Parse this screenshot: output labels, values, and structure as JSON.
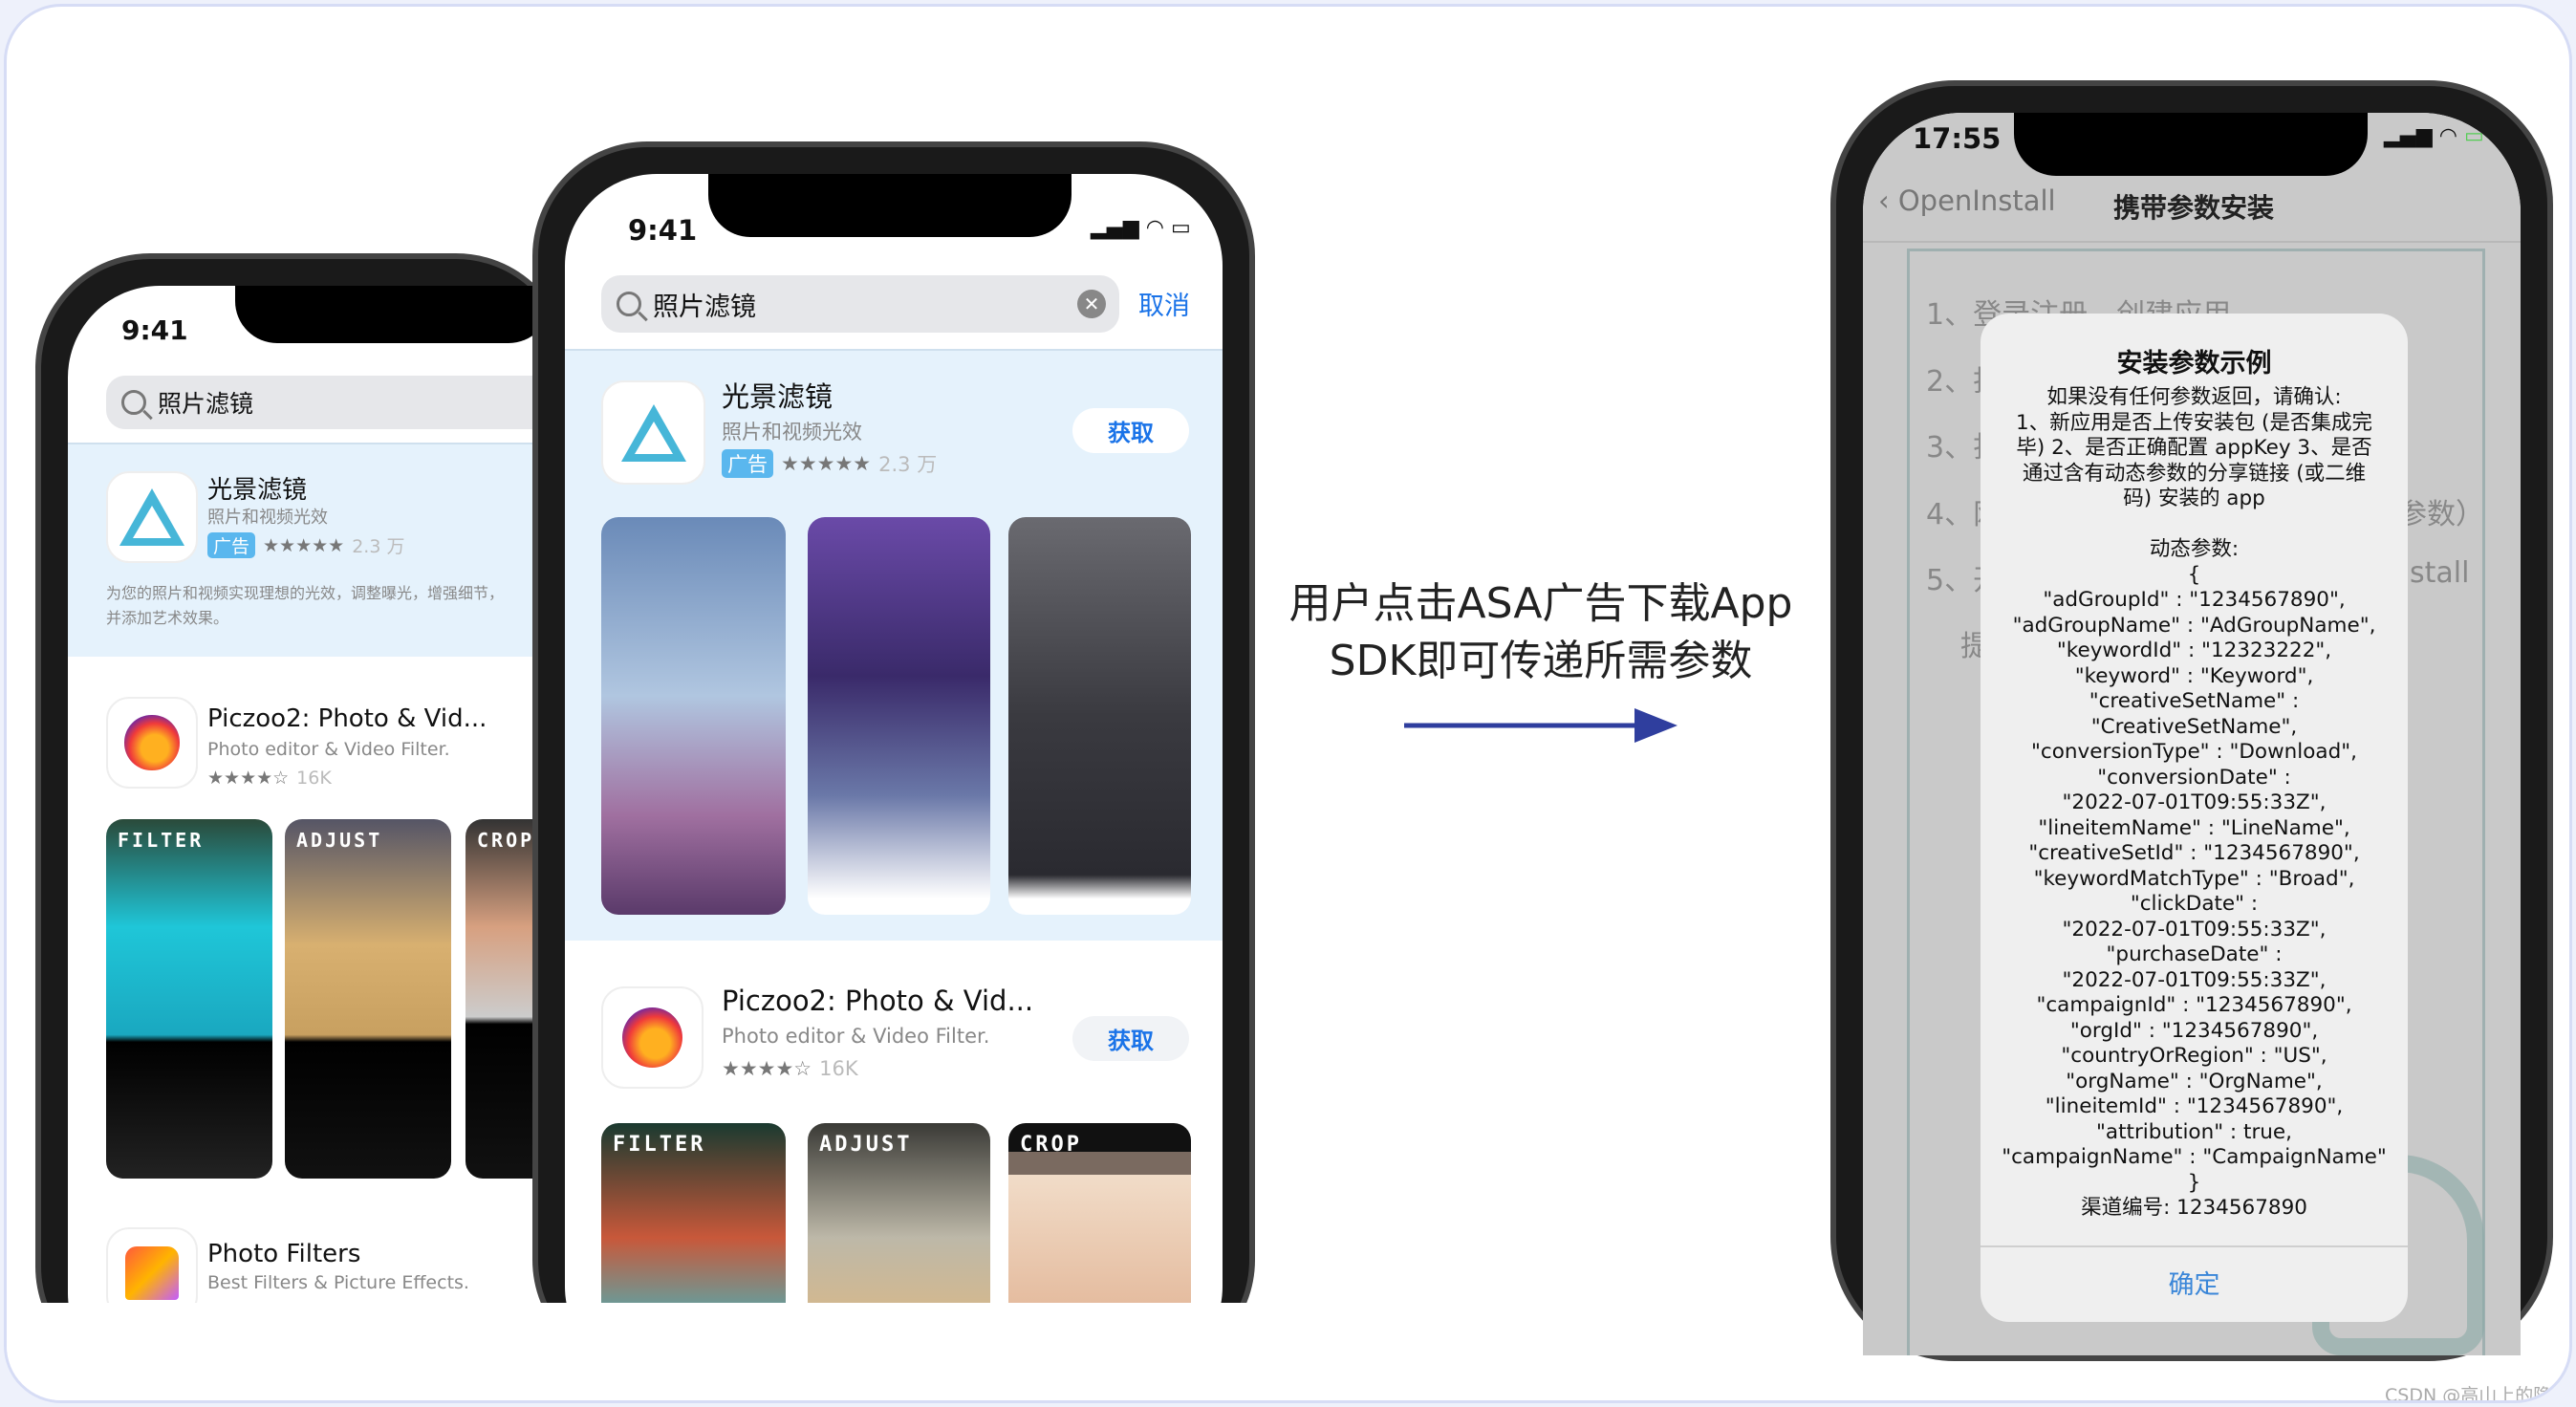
{
  "phone_back": {
    "time": "9:41",
    "search_value": "照片滤镜",
    "featured": {
      "title": "光景滤镜",
      "subtitle": "照片和视频光效",
      "ad_label": "广告",
      "stars": "★★★★★",
      "rating_count": "2.3 万",
      "description_lines": [
        "为您的照片和视频实现理想的光效，调整曝光，增强细节，",
        "并添加艺术效果。"
      ]
    },
    "app2": {
      "title": "Piczoo2: Photo & Vid...",
      "subtitle": "Photo editor & Video Filter.",
      "stars": "★★★★☆",
      "rating_count": "16K"
    },
    "screenshot_labels": [
      "FILTER",
      "ADJUST",
      "CROP"
    ],
    "app3": {
      "title": "Photo Filters",
      "subtitle": "Best Filters & Picture Effects."
    }
  },
  "phone_front": {
    "time": "9:41",
    "search_value": "照片滤镜",
    "cancel_label": "取消",
    "featured": {
      "title": "光景滤镜",
      "subtitle": "照片和视频光效",
      "ad_label": "广告",
      "stars": "★★★★★",
      "rating_count": "2.3 万",
      "get_label": "获取"
    },
    "app2": {
      "title": "Piczoo2: Photo & Vid...",
      "subtitle": "Photo editor & Video Filter.",
      "stars": "★★★★☆",
      "rating_count": "16K",
      "get_label": "获取"
    },
    "screenshot_labels": [
      "FILTER",
      "ADJUST",
      "CROP"
    ]
  },
  "caption": {
    "line1": "用户点击ASA广告下载App",
    "line2": "SDK即可传递所需参数"
  },
  "phone_right": {
    "time": "17:55",
    "nav_back": "OpenInstall",
    "nav_title": "携带参数安装",
    "bg_items": [
      "1、登录注册，创建应用",
      "2、找",
      "3、打",
      "4、网",
      "5、开",
      "提"
    ],
    "bg_fragments": [
      "参数）",
      "stall"
    ],
    "dialog": {
      "title": "安装参数示例",
      "lines": [
        "如果没有任何参数返回，请确认:",
        "1、新应用是否上传安装包 (是否集成完",
        "毕)  2、是否正确配置 appKey  3、是否",
        "通过含有动态参数的分享链接 (或二维",
        "码) 安装的 app",
        "",
        "动态参数:",
        "{",
        "\"adGroupId\" : \"1234567890\",",
        "\"adGroupName\" : \"AdGroupName\",",
        "\"keywordId\" : \"12323222\",",
        "\"keyword\" : \"Keyword\",",
        "\"creativeSetName\" :",
        "\"CreativeSetName\",",
        "\"conversionType\" : \"Download\",",
        "\"conversionDate\" :",
        "\"2022-07-01T09:55:33Z\",",
        "\"lineitemName\" : \"LineName\",",
        "\"creativeSetId\" : \"1234567890\",",
        "\"keywordMatchType\" : \"Broad\",",
        "\"clickDate\" :",
        "\"2022-07-01T09:55:33Z\",",
        "\"purchaseDate\" :",
        "\"2022-07-01T09:55:33Z\",",
        "\"campaignId\" : \"1234567890\",",
        "\"orgId\" : \"1234567890\",",
        "\"countryOrRegion\" : \"US\",",
        "\"orgName\" : \"OrgName\",",
        "\"lineitemId\" : \"1234567890\",",
        "\"attribution\" : true,",
        "\"campaignName\" : \"CampaignName\"",
        "}",
        "渠道编号:  1234567890"
      ],
      "confirm_label": "确定"
    }
  },
  "watermark": "CSDN @高山上的隐士",
  "colors": {
    "accent": "#1a73e8",
    "highlight": "#e5f2fc",
    "arrow": "#2f3e9e",
    "ad_tag": "#5ab7ee"
  }
}
